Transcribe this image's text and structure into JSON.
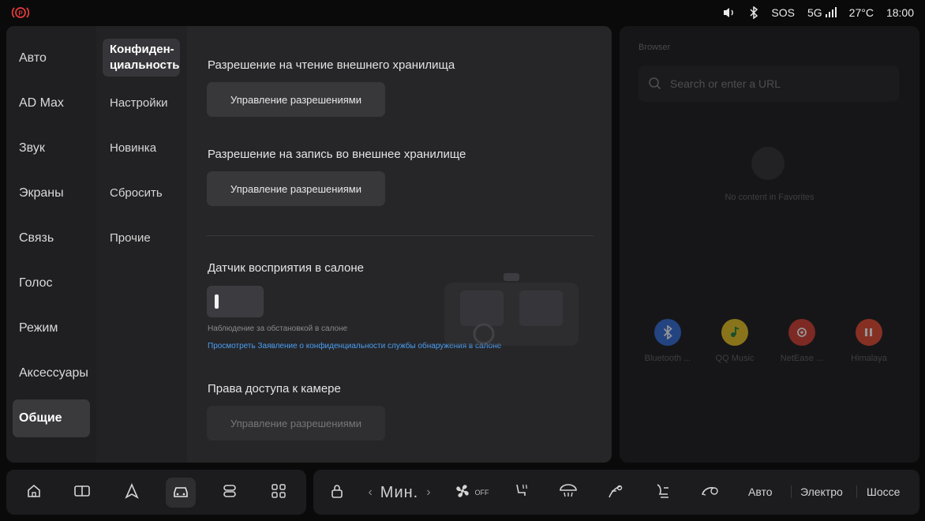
{
  "status": {
    "sound_icon": "volume-icon",
    "bluetooth_icon": "bluetooth-icon",
    "sos": "SOS",
    "network": "5G",
    "temperature": "27°C",
    "time": "18:00"
  },
  "nav": {
    "items": [
      "Авто",
      "AD Max",
      "Звук",
      "Экраны",
      "Связь",
      "Голос",
      "Режим",
      "Аксессуары",
      "Общие"
    ],
    "active": "Общие"
  },
  "subnav": {
    "active": "Конфиден-циальность",
    "items": [
      "Настройки",
      "Новинка",
      "Сбросить",
      "Прочие"
    ]
  },
  "content": {
    "read_storage_title": "Разрешение на чтение внешнего хранилища",
    "read_storage_button": "Управление разрешениями",
    "write_storage_title": "Разрешение на запись во внешнее хранилище",
    "write_storage_button": "Управление разрешениями",
    "cabin_sensor_title": "Датчик восприятия в салоне",
    "cabin_sensor_hint": "Наблюдение за обстановкой в салоне",
    "cabin_sensor_link": "Просмотреть Заявление о конфиденциальности службы обнаружения в салоне",
    "camera_title": "Права доступа к камере",
    "camera_button": "Управление разрешениями"
  },
  "browser": {
    "title": "Browser",
    "search_placeholder": "Search or enter a URL",
    "empty_favorites": "No content in Favorites",
    "apps": [
      {
        "label": "Bluetooth ...",
        "color": "#2e6bd8"
      },
      {
        "label": "QQ Music",
        "color": "#e8c21e"
      },
      {
        "label": "NetEase ...",
        "color": "#d23a2f"
      },
      {
        "label": "Himalaya",
        "color": "#e2472e"
      }
    ]
  },
  "dock": {
    "fan_speed": "Мин.",
    "fan_state": "OFF",
    "modes": [
      "Авто",
      "Электро",
      "Шоссе"
    ]
  },
  "colors": {
    "accent_link": "#4a9ff5",
    "status_red": "#e03a3a"
  }
}
